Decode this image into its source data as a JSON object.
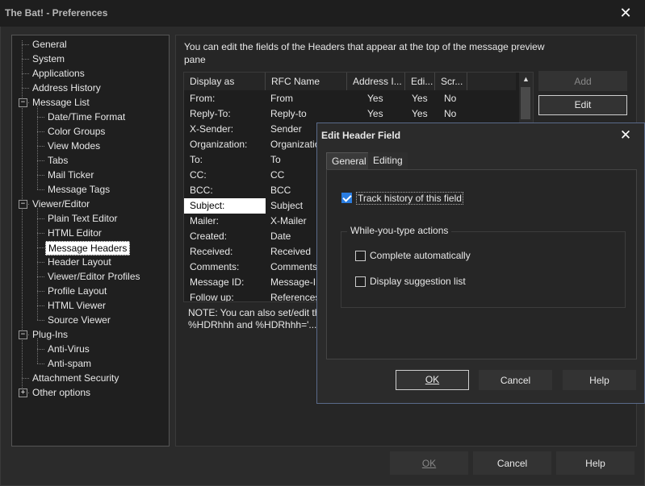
{
  "window": {
    "title": "The Bat! - Preferences",
    "close_glyph": "✕"
  },
  "tree": {
    "items": [
      {
        "label": "General",
        "level": 1
      },
      {
        "label": "System",
        "level": 1
      },
      {
        "label": "Applications",
        "level": 1
      },
      {
        "label": "Address History",
        "level": 1
      },
      {
        "label": "Message List",
        "level": 1,
        "expander": "−"
      },
      {
        "label": "Date/Time Format",
        "level": 2
      },
      {
        "label": "Color Groups",
        "level": 2
      },
      {
        "label": "View Modes",
        "level": 2
      },
      {
        "label": "Tabs",
        "level": 2
      },
      {
        "label": "Mail Ticker",
        "level": 2
      },
      {
        "label": "Message Tags",
        "level": 2
      },
      {
        "label": "Viewer/Editor",
        "level": 1,
        "expander": "−"
      },
      {
        "label": "Plain Text Editor",
        "level": 2
      },
      {
        "label": "HTML Editor",
        "level": 2
      },
      {
        "label": "Message Headers",
        "level": 2,
        "selected": true
      },
      {
        "label": "Header Layout",
        "level": 2
      },
      {
        "label": "Viewer/Editor Profiles",
        "level": 2
      },
      {
        "label": "Profile Layout",
        "level": 2
      },
      {
        "label": "HTML Viewer",
        "level": 2
      },
      {
        "label": "Source Viewer",
        "level": 2
      },
      {
        "label": "Plug-Ins",
        "level": 1,
        "expander": "−"
      },
      {
        "label": "Anti-Virus",
        "level": 2
      },
      {
        "label": "Anti-spam",
        "level": 2
      },
      {
        "label": "Attachment Security",
        "level": 1
      },
      {
        "label": "Other options",
        "level": 1,
        "expander": "+"
      }
    ]
  },
  "panel": {
    "description": "You can edit the fields of the Headers that appear at the top of the message preview pane",
    "columns": [
      "Display as",
      "RFC Name",
      "Address I...",
      "Edi...",
      "Scr..."
    ],
    "rows": [
      [
        "From:",
        "From",
        "Yes",
        "Yes",
        "No"
      ],
      [
        "Reply-To:",
        "Reply-to",
        "Yes",
        "Yes",
        "No"
      ],
      [
        "X-Sender:",
        "Sender",
        "",
        "",
        ""
      ],
      [
        "Organization:",
        "Organization",
        "",
        "",
        ""
      ],
      [
        "To:",
        "To",
        "",
        "",
        ""
      ],
      [
        "CC:",
        "CC",
        "",
        "",
        ""
      ],
      [
        "BCC:",
        "BCC",
        "",
        "",
        ""
      ],
      [
        "Subject:",
        "Subject",
        "",
        "",
        ""
      ],
      [
        "Mailer:",
        "X-Mailer",
        "",
        "",
        ""
      ],
      [
        "Created:",
        "Date",
        "",
        "",
        ""
      ],
      [
        "Received:",
        "Received",
        "",
        "",
        ""
      ],
      [
        "Comments:",
        "Comments",
        "",
        "",
        ""
      ],
      [
        "Message ID:",
        "Message-ID",
        "",
        "",
        ""
      ],
      [
        "Follow up:",
        "References",
        "",
        "",
        ""
      ]
    ],
    "selected_row": 7,
    "note_line1": "NOTE: You can also set/edit th",
    "note_line2": "%HDRhhh and %HDRhhh='...'",
    "buttons": {
      "add": "Add",
      "edit": "Edit"
    }
  },
  "footer": {
    "ok": "OK",
    "cancel": "Cancel",
    "help": "Help"
  },
  "dialog": {
    "title": "Edit Header Field",
    "tabs": [
      "General",
      "Editing"
    ],
    "track_history": {
      "label": "Track history of this field",
      "checked": true
    },
    "group_label": "While-you-type actions",
    "complete_auto": {
      "label": "Complete automatically",
      "checked": false
    },
    "display_suggestion": {
      "label": "Display suggestion list",
      "checked": false
    },
    "buttons": {
      "ok": "OK",
      "cancel": "Cancel",
      "help": "Help"
    }
  },
  "icons": {
    "close": "close-icon",
    "scroll_up": "arrow-up-icon"
  },
  "colors": {
    "accent": "#2a7de1",
    "dialog_border": "#5a6a8a",
    "background": "#2b2b2b"
  }
}
